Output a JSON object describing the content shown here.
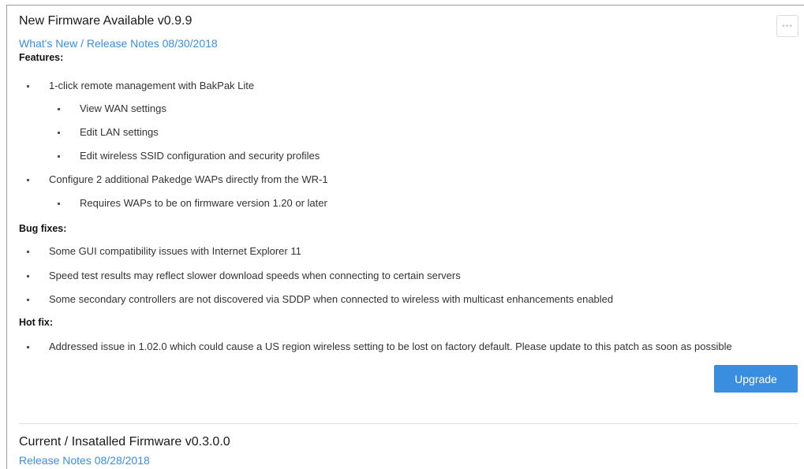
{
  "new_firmware": {
    "title": "New Firmware Available v0.9.9",
    "release_link": "What's New / Release Notes 08/30/2018",
    "more_label": "•••",
    "features_heading": "Features:",
    "features": [
      "1-click remote management with BakPak Lite",
      "View WAN settings",
      "Edit LAN settings",
      "Edit wireless SSID configuration and security profiles",
      "Configure 2 additional Pakedge WAPs directly from the WR-1",
      "Requires WAPs to be on firmware version 1.20 or later"
    ],
    "bugfix_heading": "Bug fixes:",
    "bugfixes": [
      "Some GUI compatibility issues with Internet Explorer 11",
      "Speed test results may reflect slower download speeds when connecting to certain servers",
      "Some secondary controllers are not discovered via SDDP when connected to wireless with multicast enhancements enabled"
    ],
    "hotfix_heading": "Hot fix:",
    "hotfixes": [
      "Addressed issue in 1.02.0 which could cause a US region wireless setting to be lost on factory default. Please update to this patch as soon as possible"
    ],
    "upgrade_label": "Upgrade"
  },
  "current_firmware": {
    "title": "Current / Insatalled Firmware v0.3.0.0",
    "release_link": "Release Notes 08/28/2018"
  },
  "colors": {
    "accent": "#3a8ee0",
    "text": "#333333"
  }
}
